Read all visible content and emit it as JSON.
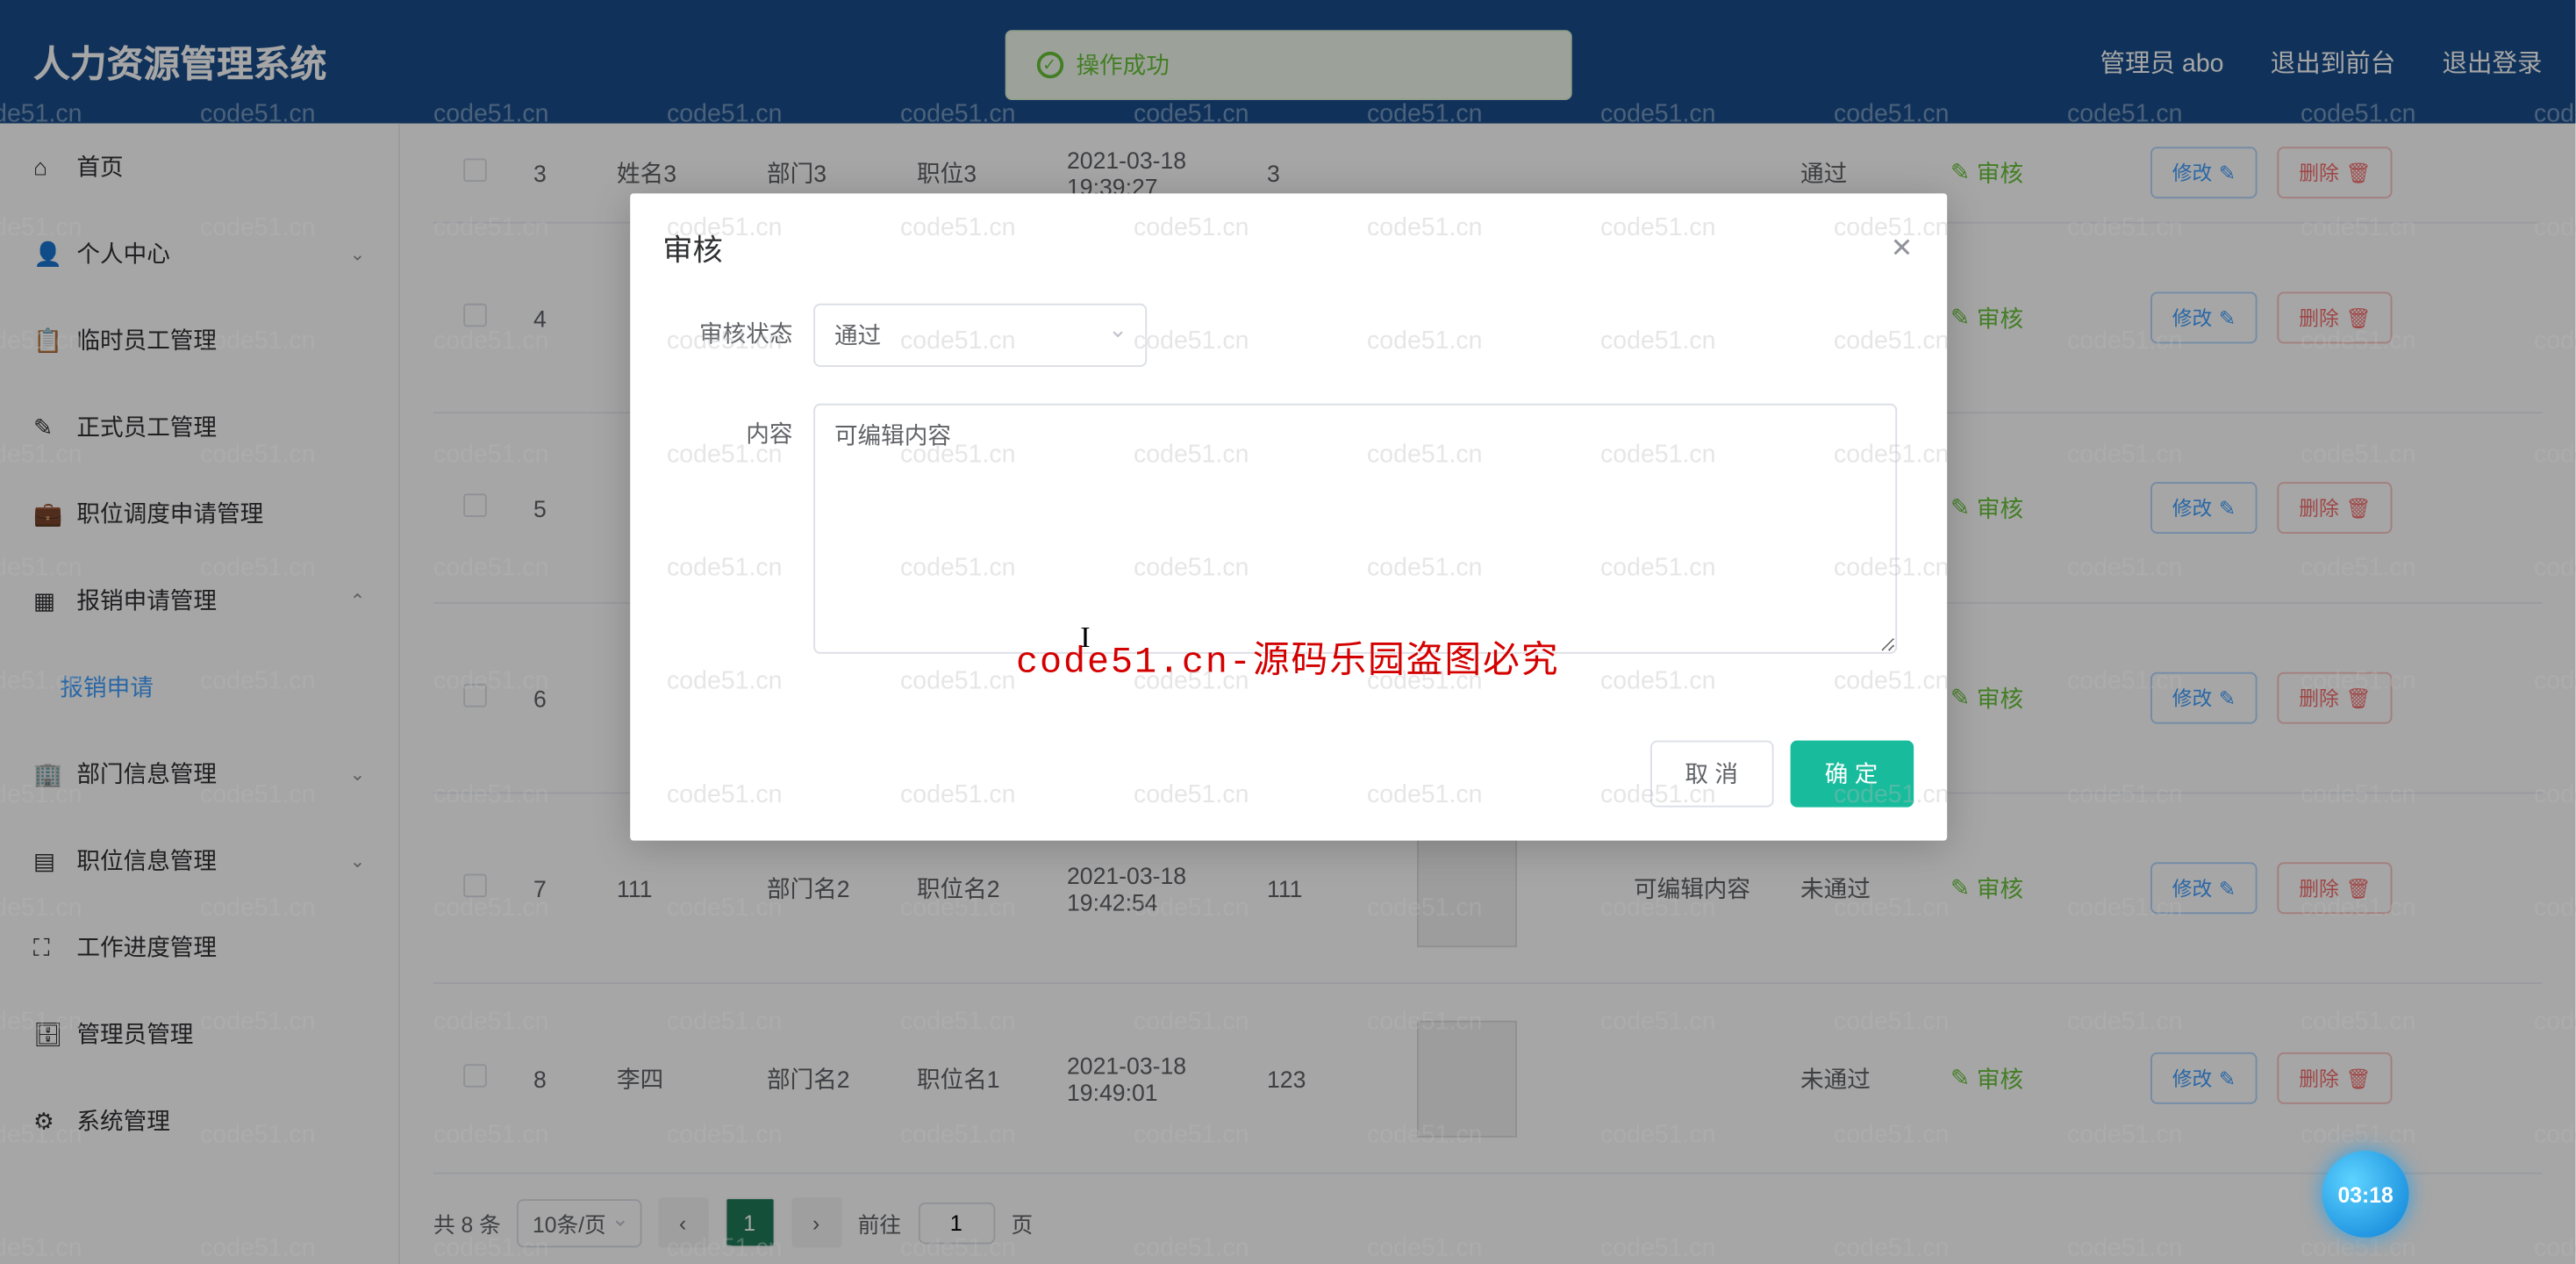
{
  "header": {
    "title": "人力资源管理系统",
    "user_label": "管理员 abo",
    "exit_front": "退出到前台",
    "logout": "退出登录"
  },
  "toast": {
    "text": "操作成功"
  },
  "sidebar": {
    "items": [
      {
        "label": "首页",
        "has_sub": false
      },
      {
        "label": "个人中心",
        "has_sub": true
      },
      {
        "label": "临时员工管理",
        "has_sub": false
      },
      {
        "label": "正式员工管理",
        "has_sub": false
      },
      {
        "label": "职位调度申请管理",
        "has_sub": false
      },
      {
        "label": "报销申请管理",
        "has_sub": true,
        "open": true
      },
      {
        "label": "报销申请",
        "active": true
      },
      {
        "label": "部门信息管理",
        "has_sub": true
      },
      {
        "label": "职位信息管理",
        "has_sub": true
      },
      {
        "label": "工作进度管理",
        "has_sub": false
      },
      {
        "label": "管理员管理",
        "has_sub": false
      },
      {
        "label": "系统管理",
        "has_sub": false
      }
    ]
  },
  "table": {
    "rows": [
      {
        "idx": "3",
        "name": "姓名3",
        "dept": "部门3",
        "pos": "职位3",
        "date": "2021-03-18 19:39:27",
        "num": "3",
        "desc": "",
        "status": "通过",
        "short": true
      },
      {
        "idx": "4",
        "name": "",
        "dept": "",
        "pos": "",
        "date": "",
        "num": "",
        "desc": "",
        "status": ""
      },
      {
        "idx": "5",
        "name": "",
        "dept": "",
        "pos": "",
        "date": "",
        "num": "",
        "desc": "",
        "status": ""
      },
      {
        "idx": "6",
        "name": "",
        "dept": "",
        "pos": "",
        "date": "",
        "num": "",
        "desc": "",
        "status": ""
      },
      {
        "idx": "7",
        "name": "111",
        "dept": "部门名2",
        "pos": "职位名2",
        "date": "2021-03-18 19:42:54",
        "num": "111",
        "desc": "可编辑内容",
        "status": "未通过"
      },
      {
        "idx": "8",
        "name": "李四",
        "dept": "部门名2",
        "pos": "职位名1",
        "date": "2021-03-18 19:49:01",
        "num": "123",
        "desc": "",
        "status": "未通过"
      }
    ],
    "audit_text": "审核",
    "edit_text": "修改",
    "delete_text": "删除"
  },
  "pagination": {
    "total_text": "共 8 条",
    "pagesize": "10条/页",
    "current": "1",
    "jump_prefix": "前往",
    "jump_value": "1",
    "jump_suffix": "页"
  },
  "dialog": {
    "title": "审核",
    "status_label": "审核状态",
    "status_value": "通过",
    "content_label": "内容",
    "content_value": "可编辑内容",
    "cancel": "取 消",
    "confirm": "确 定"
  },
  "watermark": {
    "text": "code51.cn",
    "center": "code51.cn-源码乐园盗图必究"
  },
  "video": {
    "time": "03:18"
  }
}
